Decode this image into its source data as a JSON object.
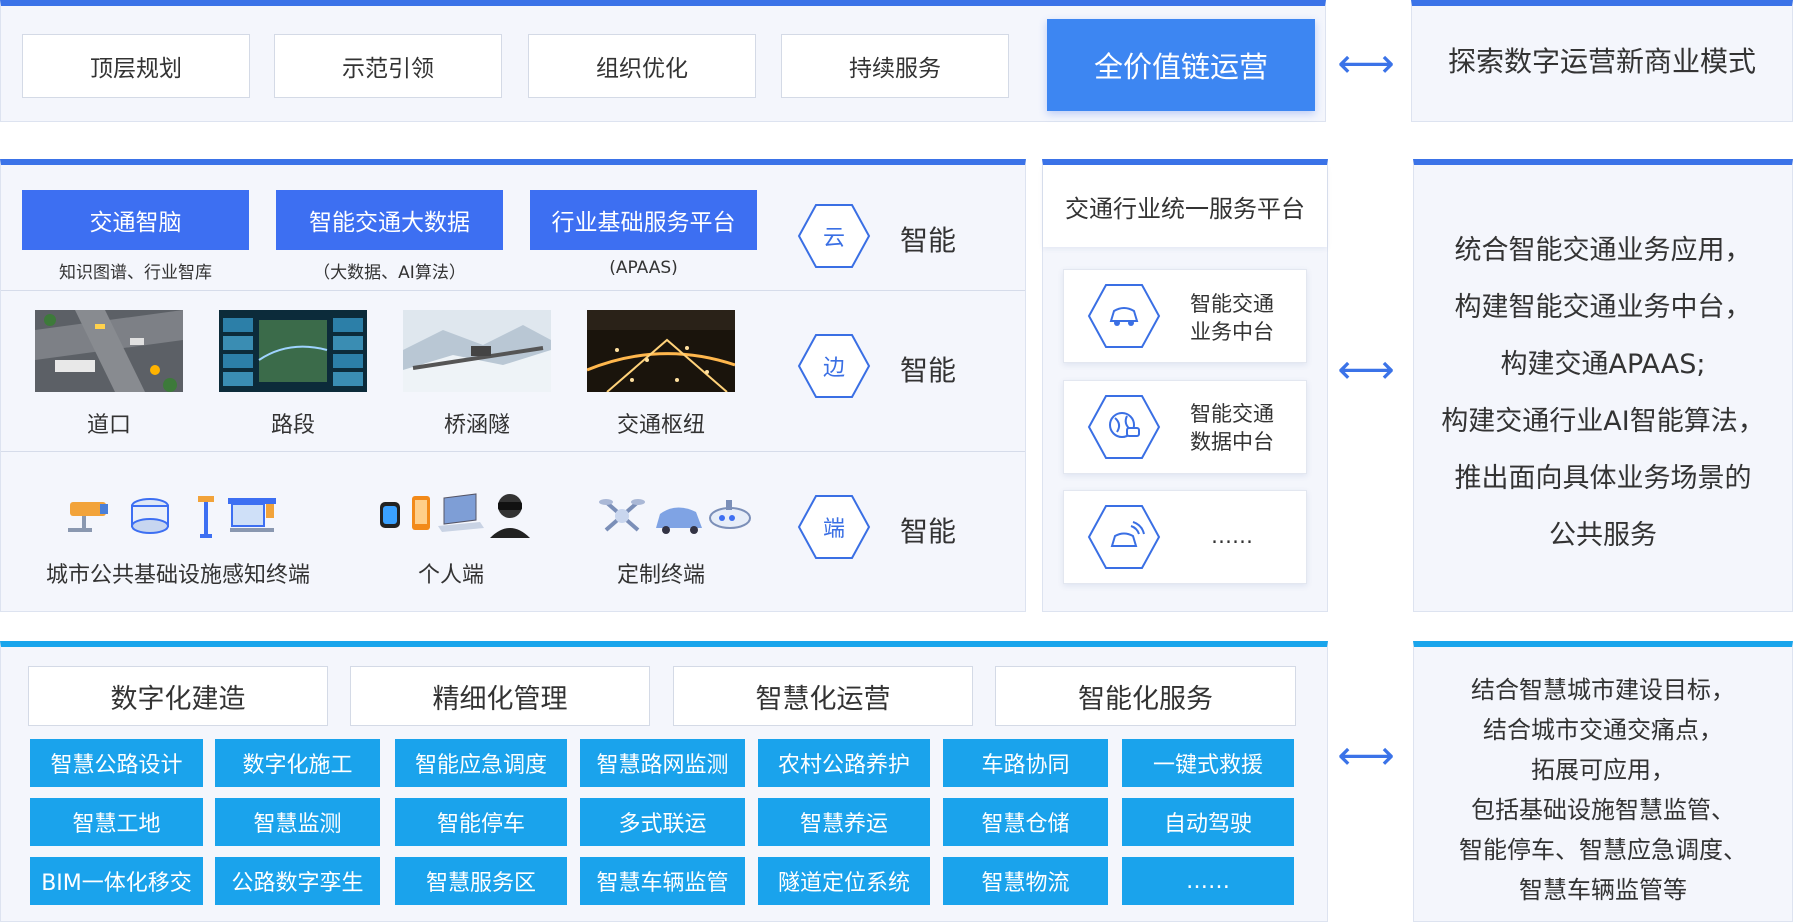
{
  "top": {
    "items": [
      "顶层规划",
      "示范引领",
      "组织优化",
      "持续服务"
    ],
    "highlight": "全价值链运营",
    "right": "探索数字运营新商业模式"
  },
  "middle": {
    "cloud": {
      "buttons": [
        {
          "label": "交通智脑",
          "sub": "知识图谱、行业智库"
        },
        {
          "label": "智能交通大数据",
          "sub": "（大数据、AI算法）"
        },
        {
          "label": "行业基础服务平台",
          "sub": "(APAAS)"
        }
      ],
      "hex": "云",
      "tag": "智能"
    },
    "edge": {
      "items": [
        "道口",
        "路段",
        "桥涵隧",
        "交通枢纽"
      ],
      "hex": "边",
      "tag": "智能"
    },
    "terminal": {
      "items": [
        "城市公共基础设施感知终端",
        "个人端",
        "定制终端"
      ],
      "hex": "端",
      "tag": "智能"
    },
    "platform": {
      "title": "交通行业统一服务平台",
      "cards": [
        "智能交通\n业务中台",
        "智能交通\n数据中台",
        "……"
      ]
    },
    "right": [
      "统合智能交通业务应用，",
      "构建智能交通业务中台，",
      "构建交通APAAS;",
      "构建交通行业AI智能算法，",
      "推出面向具体业务场景的",
      "公共服务"
    ]
  },
  "bottom": {
    "headers": [
      "数字化建造",
      "精细化管理",
      "智慧化运营",
      "智能化服务"
    ],
    "grid": [
      [
        "智慧公路设计",
        "数字化施工",
        "智能应急调度",
        "智慧路网监测",
        "农村公路养护",
        "车路协同",
        "一键式救援"
      ],
      [
        "智慧工地",
        "智慧监测",
        "智能停车",
        "多式联运",
        "智慧养运",
        "智慧仓储",
        "自动驾驶"
      ],
      [
        "BIM一体化移交",
        "公路数字孪生",
        "智慧服务区",
        "智慧车辆监管",
        "隧道定位系统",
        "智慧物流",
        "……"
      ]
    ],
    "right": [
      "结合智慧城市建设目标，",
      "结合城市交通交痛点，",
      "拓展可应用，",
      "包括基础设施智慧监管、",
      "智能停车、智慧应急调度、",
      "智慧车辆监管等"
    ]
  },
  "arrow": "⟷",
  "colors": {
    "blue": "#3d6ff2",
    "cyan": "#1aa3ec",
    "accent": "#3b73e8"
  }
}
